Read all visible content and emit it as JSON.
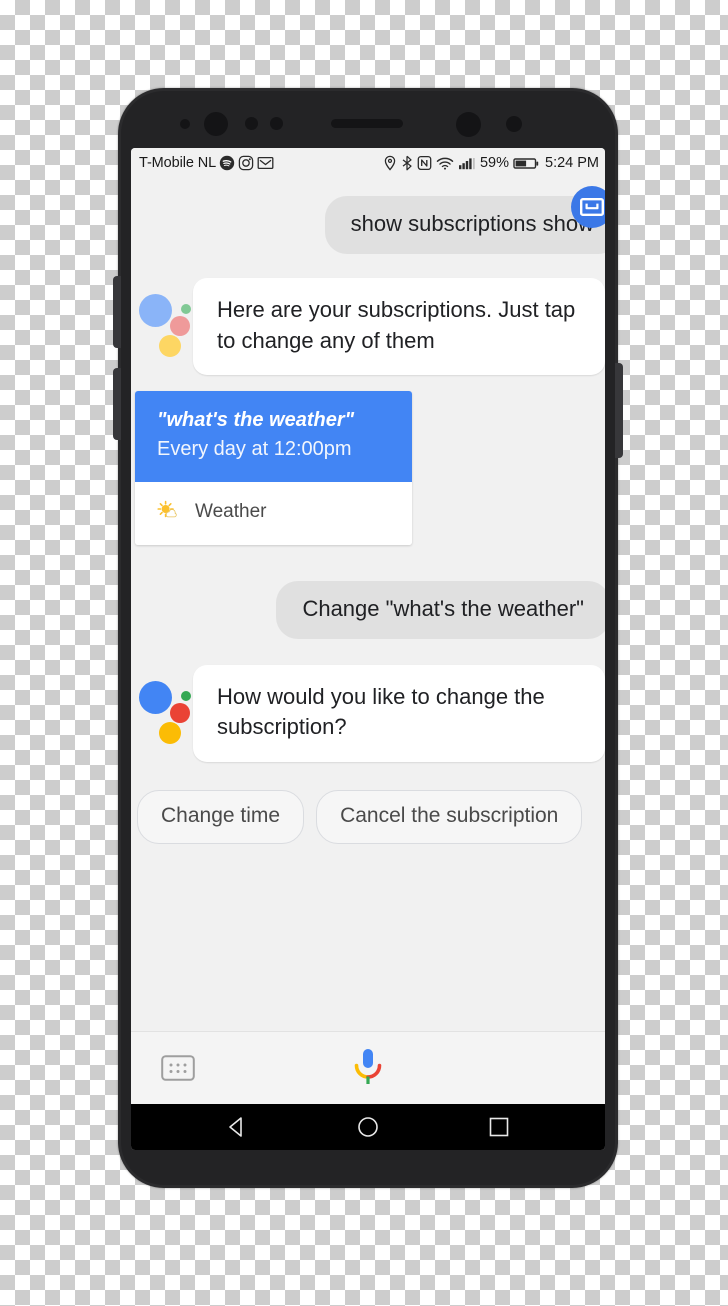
{
  "status_bar": {
    "carrier": "T-Mobile  NL",
    "left_icons": [
      "spotify-icon",
      "instagram-icon",
      "gmail-icon"
    ],
    "right_icons": [
      "location-icon",
      "bluetooth-icon",
      "nfc-icon",
      "wifi-icon",
      "signal-icon"
    ],
    "battery_percent": "59%",
    "battery_icon": "battery-icon",
    "clock": "5:24 PM"
  },
  "conversation": {
    "user_message_1": "show subscriptions show",
    "user_avatar_icon": "keyboard-input-icon",
    "assistant_message_1": "Here are your subscriptions. Just tap to change any of them",
    "assistant_logo_icon": "google-assistant-logo",
    "subscription_card": {
      "title": "\"what's the weather\"",
      "subtitle": "Every day at 12:00pm",
      "app_icon": "weather-sun-icon",
      "app_label": "Weather"
    },
    "user_message_2": "Change \"what's the weather\"",
    "assistant_message_2": "How would you like to change the subscription?"
  },
  "suggestion_chips": [
    {
      "label": "Change time"
    },
    {
      "label": "Cancel the subscription"
    }
  ],
  "input_bar": {
    "keyboard_icon": "keyboard-icon",
    "mic_icon": "google-mic-icon"
  },
  "nav_bar": {
    "back_icon": "back-triangle-icon",
    "home_icon": "home-circle-icon",
    "recents_icon": "recents-square-icon"
  },
  "colors": {
    "accent_blue": "#4285f4",
    "avatar_blue": "#3b78e7",
    "user_bubble_gray": "#e0e0e0",
    "screen_bg": "#f1f1f1",
    "assistant_bubble": "#ffffff",
    "google_red": "#ea4335",
    "google_yellow": "#fbbc05",
    "google_green": "#34a853"
  }
}
